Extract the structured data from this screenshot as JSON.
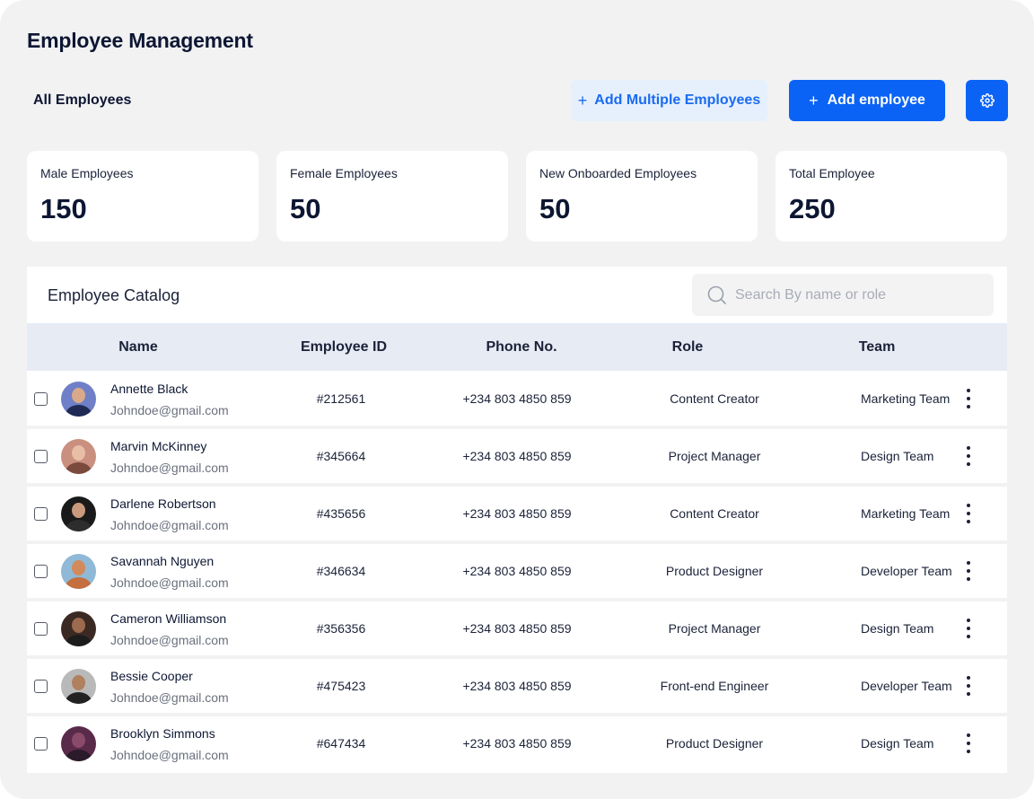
{
  "header": {
    "title": "Employee Management",
    "section_label": "All Employees",
    "add_multiple_label": "Add Multiple Employees",
    "add_employee_label": "Add employee",
    "settings_icon": "gear-icon"
  },
  "stats": [
    {
      "label": "Male Employees",
      "value": "150"
    },
    {
      "label": "Female Employees",
      "value": "50"
    },
    {
      "label": "New Onboarded Employees",
      "value": "50"
    },
    {
      "label": "Total Employee",
      "value": "250"
    }
  ],
  "catalog": {
    "title": "Employee Catalog",
    "search_placeholder": "Search By name or role",
    "columns": [
      "Name",
      "Employee ID",
      "Phone No.",
      "Role",
      "Team"
    ],
    "rows": [
      {
        "name": "Annette Black",
        "email": "Johndoe@gmail.com",
        "id": "#212561",
        "phone": "+234 803 4850 859",
        "role": "Content Creator",
        "team": "Marketing Team"
      },
      {
        "name": "Marvin McKinney",
        "email": "Johndoe@gmail.com",
        "id": "#345664",
        "phone": "+234 803 4850 859",
        "role": "Project Manager",
        "team": "Design Team"
      },
      {
        "name": "Darlene Robertson",
        "email": "Johndoe@gmail.com",
        "id": "#435656",
        "phone": "+234 803 4850 859",
        "role": "Content Creator",
        "team": "Marketing Team"
      },
      {
        "name": "Savannah Nguyen",
        "email": "Johndoe@gmail.com",
        "id": "#346634",
        "phone": "+234 803 4850 859",
        "role": "Product Designer",
        "team": "Developer Team"
      },
      {
        "name": "Cameron Williamson",
        "email": "Johndoe@gmail.com",
        "id": "#356356",
        "phone": "+234 803 4850 859",
        "role": "Project Manager",
        "team": "Design Team"
      },
      {
        "name": "Bessie Cooper",
        "email": "Johndoe@gmail.com",
        "id": "#475423",
        "phone": "+234 803 4850 859",
        "role": "Front-end Engineer",
        "team": "Developer Team"
      },
      {
        "name": "Brooklyn Simmons",
        "email": "Johndoe@gmail.com",
        "id": "#647434",
        "phone": "+234 803 4850 859",
        "role": "Product Designer",
        "team": "Design Team"
      }
    ]
  },
  "colors": {
    "primary": "#0b63f6",
    "primary_light": "#e6f0fd",
    "table_header_bg": "#e6ebf4",
    "page_bg": "#f2f2f3"
  }
}
